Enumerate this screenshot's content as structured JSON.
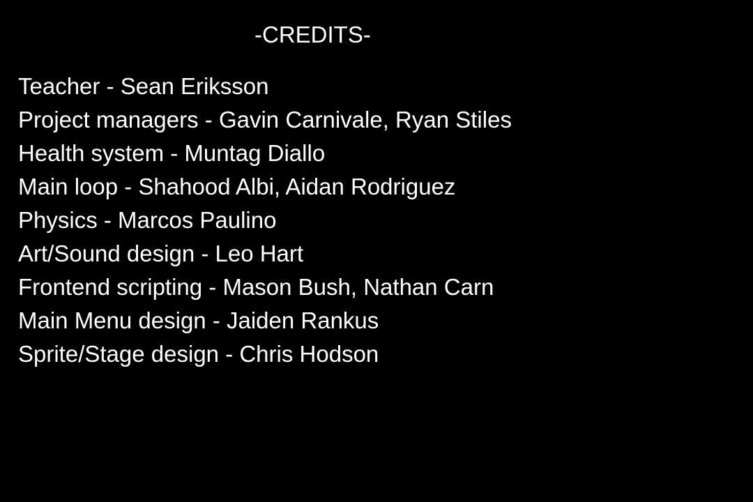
{
  "title": "-CREDITS-",
  "credits": [
    "Teacher - Sean Eriksson",
    "Project managers - Gavin Carnivale, Ryan Stiles",
    "Health system - Muntag Diallo",
    "Main loop - Shahood Albi, Aidan Rodriguez",
    "Physics - Marcos Paulino",
    "Art/Sound design - Leo Hart",
    "Frontend scripting - Mason Bush, Nathan Carn",
    "Main Menu design - Jaiden Rankus",
    "Sprite/Stage design - Chris Hodson"
  ],
  "colors": {
    "background": "#000000",
    "text": "#ffffff"
  }
}
